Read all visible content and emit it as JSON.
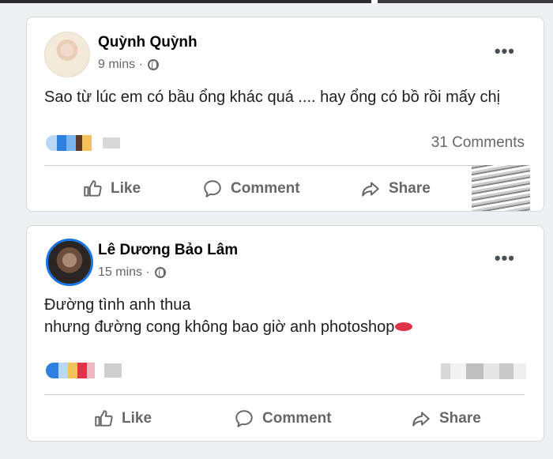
{
  "posts": [
    {
      "author": "Quỳnh Quỳnh",
      "time": "9 mins ·",
      "text": "Sao từ lúc em có bầu ổng khác quá .... hay ổng có bồ rồi mấy chị",
      "comments": "31 Comments",
      "more": "•••",
      "actions": {
        "like": "Like",
        "comment": "Comment",
        "share": "Share"
      }
    },
    {
      "author": "Lê Dương Bảo Lâm",
      "time": "15 mins ·",
      "text_line1": "Đường tình anh thua",
      "text_line2": "nhưng đường cong không bao giờ anh photoshop",
      "more": "•••",
      "actions": {
        "like": "Like",
        "comment": "Comment",
        "share": "Share"
      }
    }
  ],
  "icons": [
    "globe-icon",
    "like-icon",
    "comment-icon",
    "share-icon",
    "more-icon",
    "lips-emoji"
  ],
  "colors": {
    "accent": "#1b74e4",
    "text_secondary": "#65676b",
    "background": "#eef0f3"
  }
}
